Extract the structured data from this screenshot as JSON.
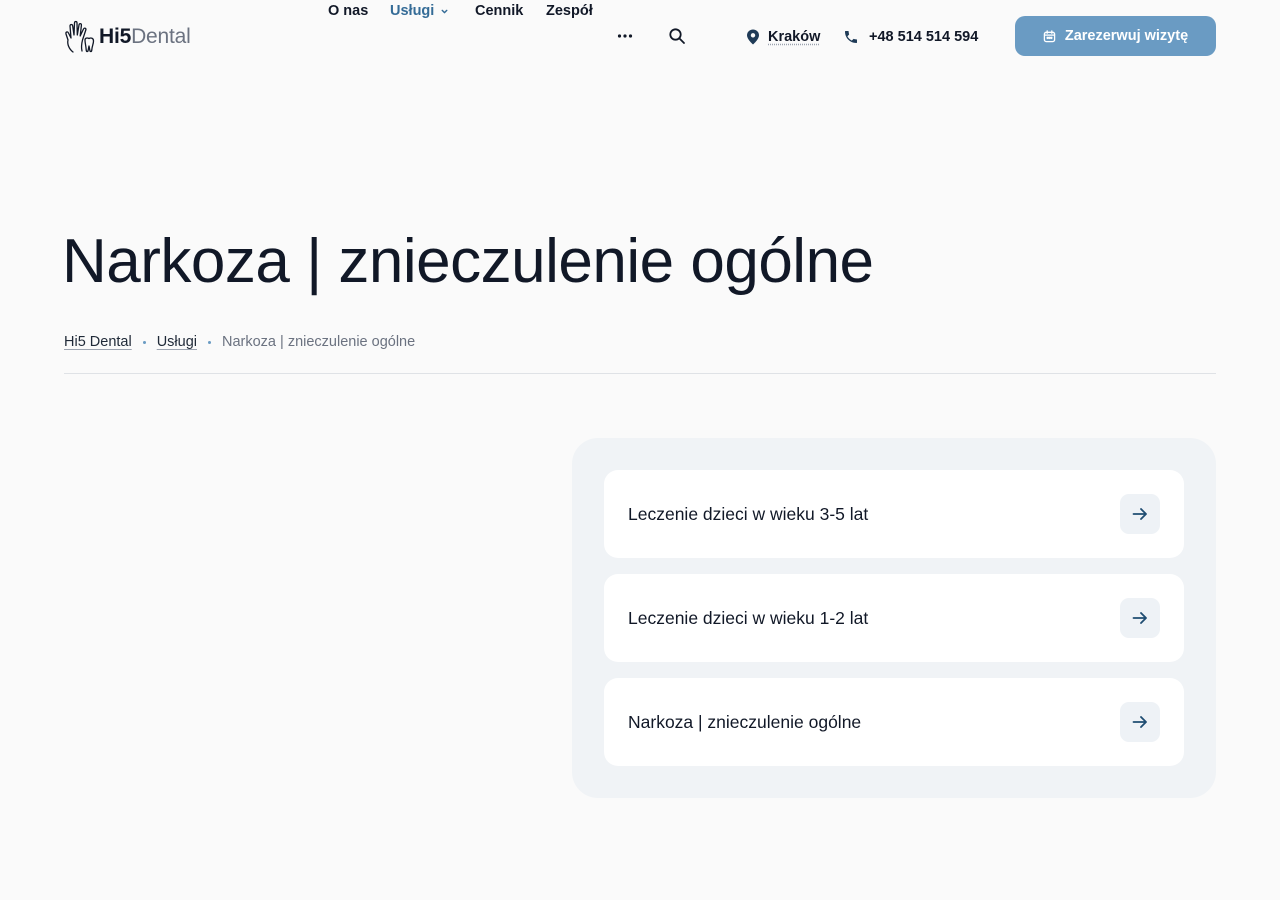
{
  "brand": {
    "name_bold": "Hi5",
    "name_light": "Dental"
  },
  "nav": {
    "items": [
      {
        "label": "O nas"
      },
      {
        "label": "Usługi"
      },
      {
        "label": "Cennik"
      },
      {
        "label": "Zespół"
      }
    ],
    "active_item": "Usługi",
    "more_icon": "more-dots-icon",
    "search_icon": "search-icon"
  },
  "location": {
    "label": "Kraków",
    "icon": "map-pin-icon"
  },
  "phone": {
    "label": "+48 514 514 594",
    "icon": "phone-icon"
  },
  "cta": {
    "label": "Zarezerwuj wizytę",
    "icon": "calendar-icon"
  },
  "page": {
    "title": "Narkoza | znieczulenie ogólne",
    "breadcrumb": [
      {
        "label": "Hi5 Dental"
      },
      {
        "label": "Usługi"
      },
      {
        "label": "Narkoza | znieczulenie ogólne"
      }
    ]
  },
  "related": {
    "items": [
      {
        "label": "Leczenie dzieci w wieku 3-5 lat"
      },
      {
        "label": "Leczenie dzieci w wieku 1-2 lat"
      },
      {
        "label": "Narkoza | znieczulenie ogólne"
      }
    ],
    "arrow_icon": "arrow-right-icon"
  },
  "colors": {
    "accent": "#6a9bc3",
    "active_nav": "#356c97",
    "background": "#fafafa",
    "card_bg": "#f0f3f6"
  }
}
